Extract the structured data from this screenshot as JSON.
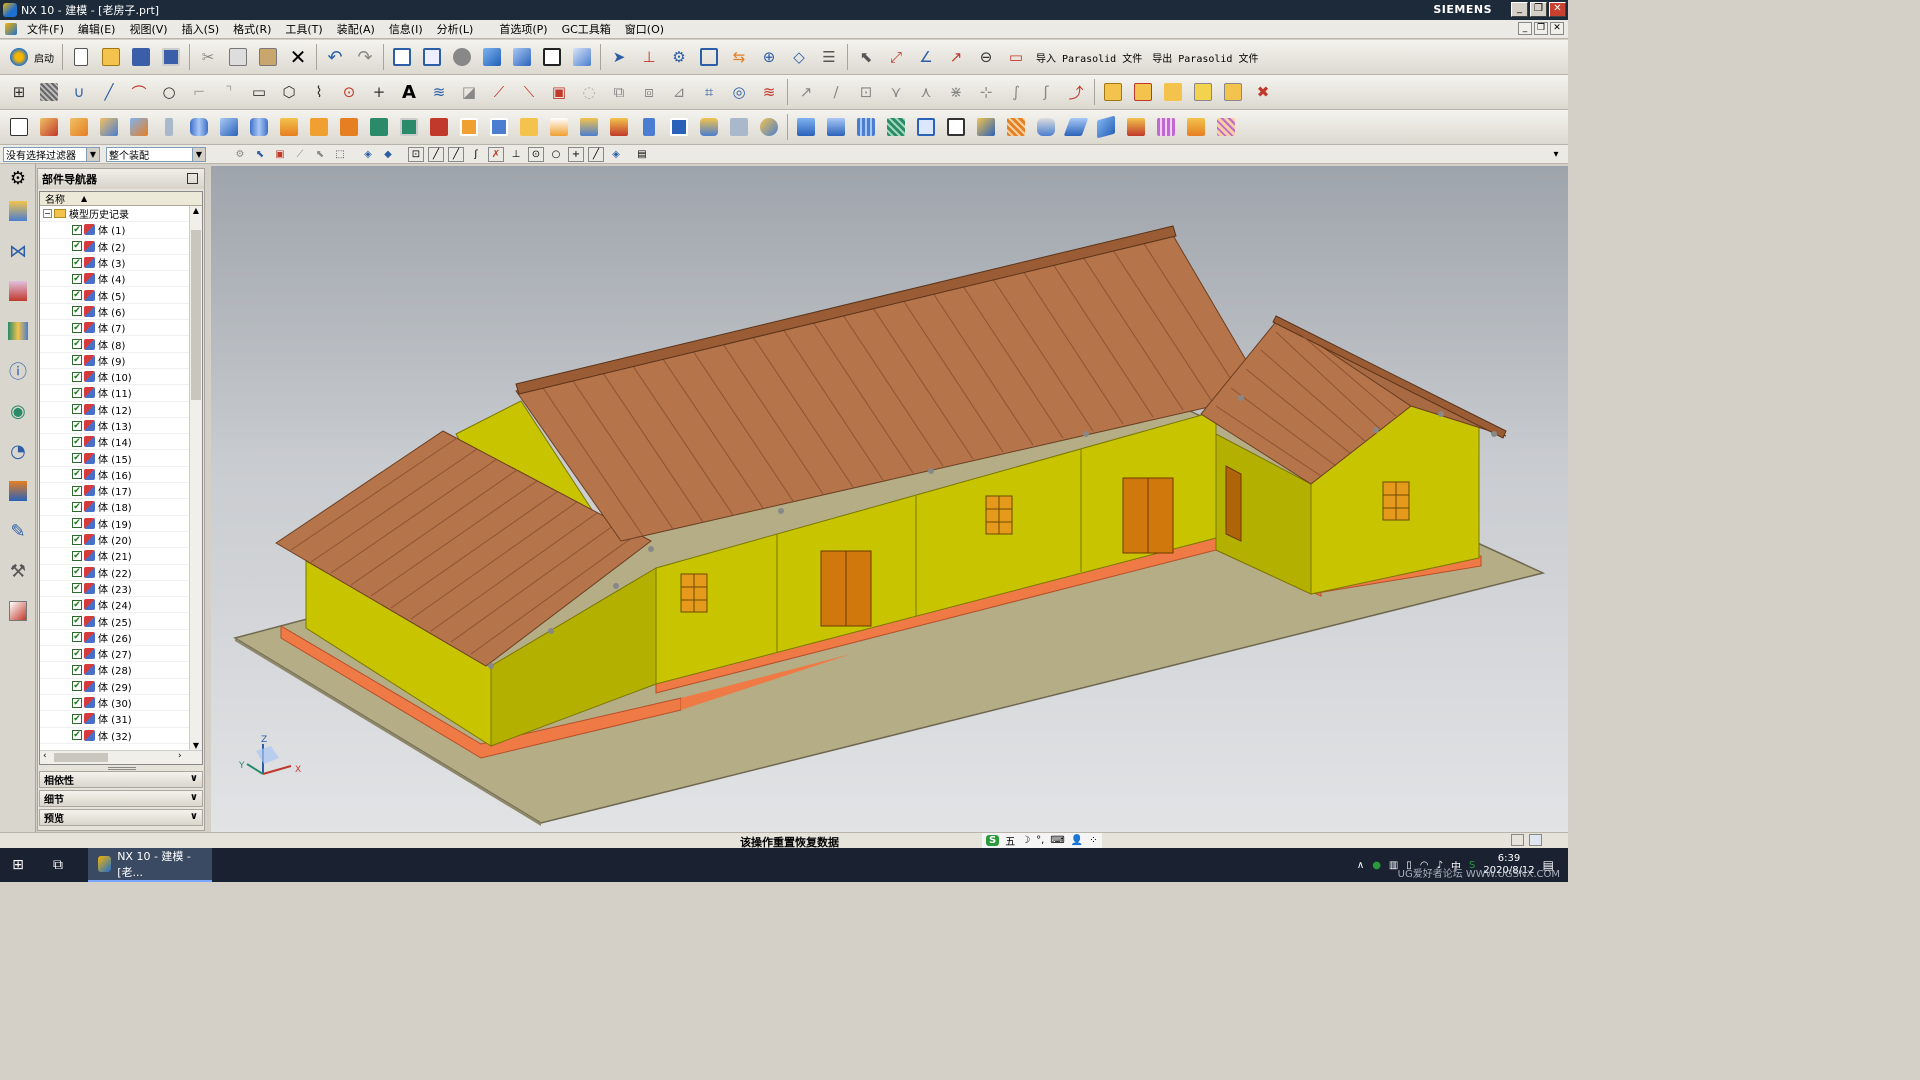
{
  "window": {
    "title": "NX 10 - 建模 - [老房子.prt]",
    "brand": "SIEMENS",
    "minimize": "_",
    "restore": "❐",
    "close": "✕"
  },
  "menubar": {
    "items": [
      "文件(F)",
      "编辑(E)",
      "视图(V)",
      "插入(S)",
      "格式(R)",
      "工具(T)",
      "装配(A)",
      "信息(I)",
      "分析(L)",
      "首选项(P)",
      "GC工具箱",
      "窗口(O)"
    ]
  },
  "toolbar1": {
    "start_label": "启动",
    "import_label": "导入 Parasolid 文件",
    "export_label": "导出 Parasolid 文件"
  },
  "selection_bar": {
    "filter_value": "没有选择过滤器",
    "scope_value": "整个装配"
  },
  "navigator": {
    "title": "部件导航器",
    "column_name": "名称",
    "root_label": "模型历史记录",
    "items": [
      "体 (1)",
      "体 (2)",
      "体 (3)",
      "体 (4)",
      "体 (5)",
      "体 (6)",
      "体 (7)",
      "体 (8)",
      "体 (9)",
      "体 (10)",
      "体 (11)",
      "体 (12)",
      "体 (13)",
      "体 (14)",
      "体 (15)",
      "体 (16)",
      "体 (17)",
      "体 (18)",
      "体 (19)",
      "体 (20)",
      "体 (21)",
      "体 (22)",
      "体 (23)",
      "体 (24)",
      "体 (25)",
      "体 (26)",
      "体 (27)",
      "体 (28)",
      "体 (29)",
      "体 (30)",
      "体 (31)",
      "体 (32)"
    ],
    "panels": [
      "相依性",
      "细节",
      "预览"
    ]
  },
  "viewport": {
    "triad": {
      "x": "X",
      "y": "Y",
      "z": "Z"
    },
    "colors": {
      "wall": "#c8c400",
      "roof": "#b5744a",
      "base": "#f07a45",
      "ground": "#b5ad86",
      "door": "#d0780c"
    }
  },
  "status": {
    "message": "该操作重置恢复数据",
    "ime": [
      "S",
      "五",
      "☽",
      "°,",
      "⌨",
      "👤",
      "⁘"
    ]
  },
  "taskbar": {
    "task_label": "NX 10 - 建模 - [老...",
    "time": "6:39",
    "date": "2020/8/12",
    "watermark": "UG爱好者论坛 WWW.UGSNX.COM"
  }
}
